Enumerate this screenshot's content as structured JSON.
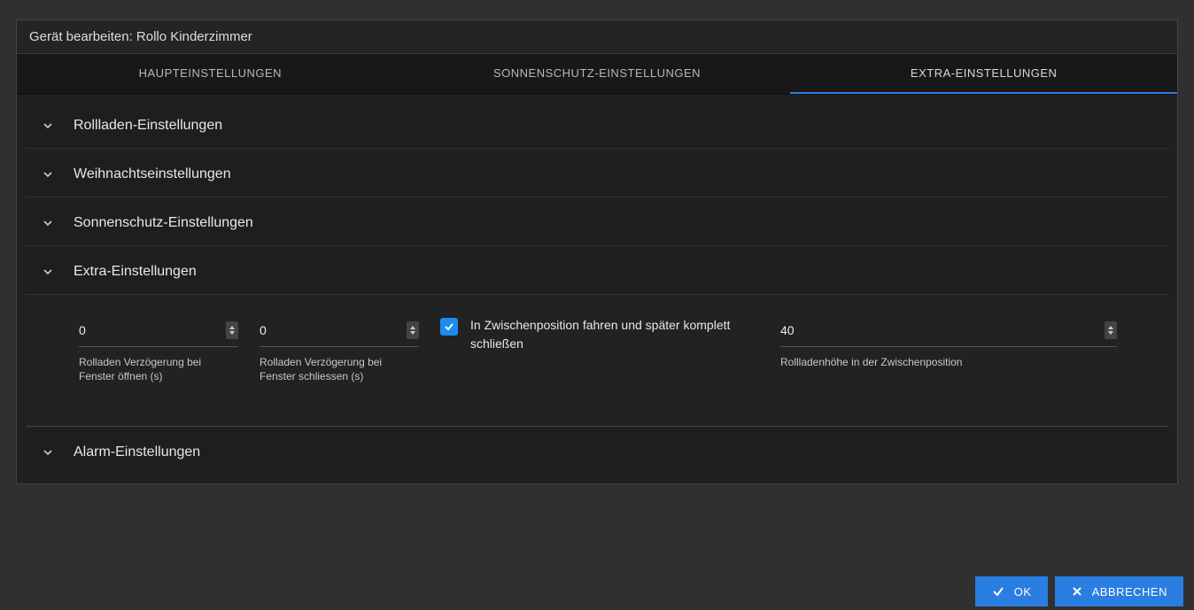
{
  "dialog": {
    "title": "Gerät bearbeiten: Rollo Kinderzimmer"
  },
  "tabs": {
    "main": "HAUPTEINSTELLUNGEN",
    "sun": "SONNENSCHUTZ-EINSTELLUNGEN",
    "extra": "EXTRA-EINSTELLUNGEN"
  },
  "sections": {
    "rollladen": "Rollladen-Einstellungen",
    "weihnacht": "Weihnachtseinstellungen",
    "sonnen": "Sonnenschutz-Einstellungen",
    "extra": "Extra-Einstellungen",
    "alarm": "Alarm-Einstellungen"
  },
  "extra": {
    "delay_open": {
      "value": "0",
      "label": "Rolladen Verzögerung bei Fenster öffnen (s)"
    },
    "delay_close": {
      "value": "0",
      "label": "Rolladen Verzögerung bei Fenster schliessen (s)"
    },
    "intermediate": {
      "checked": true,
      "label": "In Zwischenposition fahren und später komplett schließen"
    },
    "height": {
      "value": "40",
      "label": "Rollladenhöhe in der Zwischenposition"
    }
  },
  "footer": {
    "ok": "OK",
    "cancel": "ABBRECHEN"
  }
}
